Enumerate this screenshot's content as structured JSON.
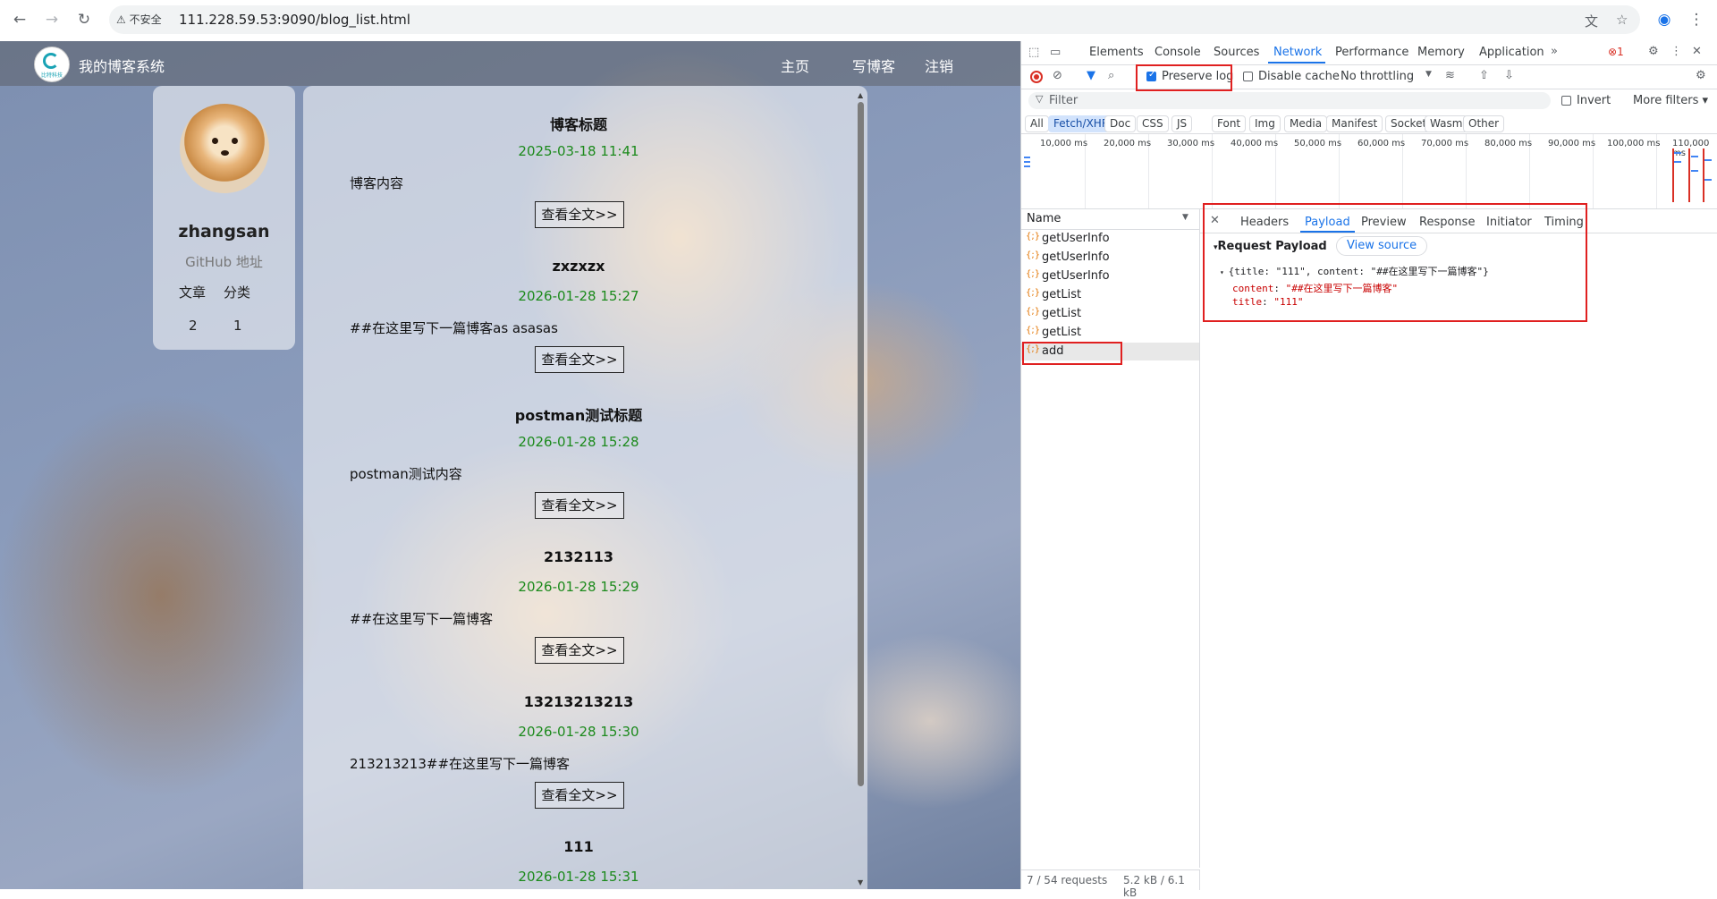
{
  "browser": {
    "security": "不安全",
    "url": "111.228.59.53:9090/blog_list.html"
  },
  "blog": {
    "site_title": "我的博客系统",
    "logo_text": "比特科技",
    "nav": {
      "home": "主页",
      "write": "写博客",
      "logout": "注销"
    },
    "user": {
      "name": "zhangsan",
      "github": "GitHub 地址",
      "articles_label": "文章",
      "categories_label": "分类",
      "articles_count": "2",
      "categories_count": "1"
    },
    "read_more_label": "查看全文>>",
    "posts": [
      {
        "title": "博客标题",
        "date": "2025-03-18 11:41",
        "desc": "博客内容"
      },
      {
        "title": "zxzxzx",
        "date": "2026-01-28 15:27",
        "desc": "##在这里写下一篇博客as asasas"
      },
      {
        "title": "postman测试标题",
        "date": "2026-01-28 15:28",
        "desc": "postman测试内容"
      },
      {
        "title": "2132113",
        "date": "2026-01-28 15:29",
        "desc": "##在这里写下一篇博客"
      },
      {
        "title": "13213213213",
        "date": "2026-01-28 15:30",
        "desc": "213213213##在这里写下一篇博客"
      },
      {
        "title": "111",
        "date": "2026-01-28 15:31",
        "desc": ""
      }
    ]
  },
  "devtools": {
    "tabs": [
      "Elements",
      "Console",
      "Sources",
      "Network",
      "Performance",
      "Memory",
      "Application"
    ],
    "active_tab": "Network",
    "error_count": "1",
    "toolbar": {
      "preserve_log": "Preserve log",
      "disable_cache": "Disable cache",
      "throttling": "No throttling"
    },
    "filter_placeholder": "Filter",
    "invert": "Invert",
    "more_filters": "More filters",
    "type_filters": [
      "All",
      "Fetch/XHR",
      "Doc",
      "CSS",
      "JS",
      "Font",
      "Img",
      "Media",
      "Manifest",
      "Socket",
      "Wasm",
      "Other"
    ],
    "active_type": "Fetch/XHR",
    "timeline_labels": [
      "10,000 ms",
      "20,000 ms",
      "30,000 ms",
      "40,000 ms",
      "50,000 ms",
      "60,000 ms",
      "70,000 ms",
      "80,000 ms",
      "90,000 ms",
      "100,000 ms",
      "110,000 ms"
    ],
    "name_header": "Name",
    "requests": [
      "getUserInfo",
      "getUserInfo",
      "getUserInfo",
      "getList",
      "getList",
      "getList",
      "add"
    ],
    "selected_request": "add",
    "status": {
      "requests": "7 / 54 requests",
      "size": "5.2 kB / 6.1 kB"
    },
    "detail_tabs": [
      "Headers",
      "Payload",
      "Preview",
      "Response",
      "Initiator",
      "Timing"
    ],
    "active_detail_tab": "Payload",
    "payload": {
      "title": "Request Payload",
      "view_source": "View source",
      "summary": "{title: \"111\", content: \"##在这里写下一篇博客\"}",
      "content_key": "content",
      "content_value": "\"##在这里写下一篇博客\"",
      "title_key": "title",
      "title_value": "\"111\""
    }
  },
  "colors": {
    "accent": "#1a73e8",
    "highlight": "#e02020",
    "date_green": "#1c8a1c"
  }
}
